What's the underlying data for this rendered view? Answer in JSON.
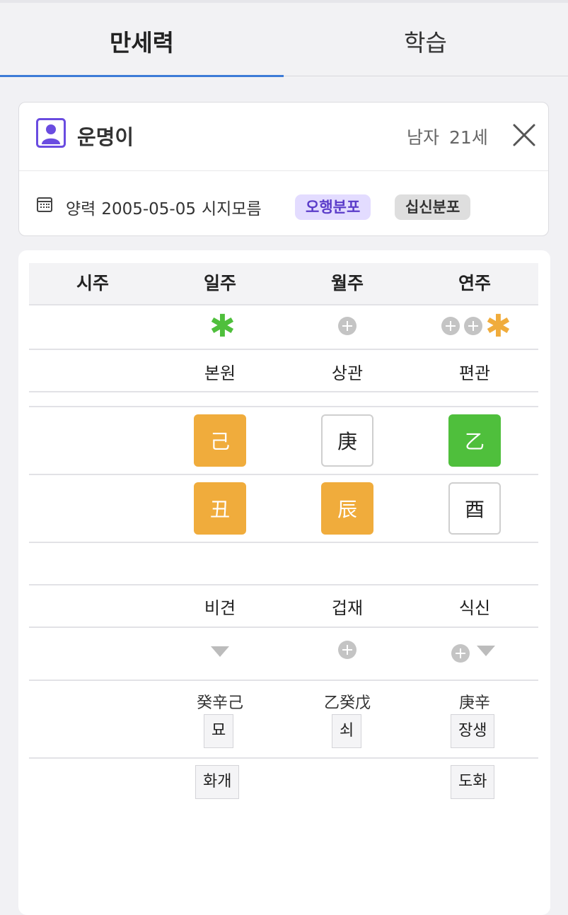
{
  "tabs": [
    "만세력",
    "학습"
  ],
  "profile": {
    "name": "운명이",
    "gender": "남자",
    "age": "21세",
    "calendar_type": "양력",
    "birth_date": "2005-05-05",
    "birth_time": "시지모름",
    "buttons": [
      "오행분포",
      "십신분포"
    ]
  },
  "columns": [
    "시주",
    "일주",
    "월주",
    "연주"
  ],
  "stem_tenGods": [
    "본원",
    "상관",
    "편관"
  ],
  "heavenly_stems": [
    "己",
    "庚",
    "乙"
  ],
  "earthly_branches": [
    "丑",
    "辰",
    "酉"
  ],
  "branch_tenGods": [
    "비견",
    "겁재",
    "식신"
  ],
  "hidden_stems": [
    "癸辛己",
    "乙癸戊",
    "庚辛"
  ],
  "twelve_stages": [
    "묘",
    "쇠",
    "장생"
  ],
  "twelve_spirits": [
    "화개",
    "",
    "도화"
  ],
  "colors": {
    "earth": "#f0ac3c",
    "wood": "#4fbf3c",
    "star_green": "#4fbf3c",
    "star_orange": "#f0ac3c",
    "tab_active": "#3d7bd7",
    "chip_purple": "#5b3cc9"
  },
  "icons": {
    "avatar": "person-icon",
    "close": "close-icon",
    "calendar": "calendar-icon",
    "star": "asterisk-icon",
    "plus": "plus-circle-icon",
    "down": "triangle-down-icon"
  }
}
